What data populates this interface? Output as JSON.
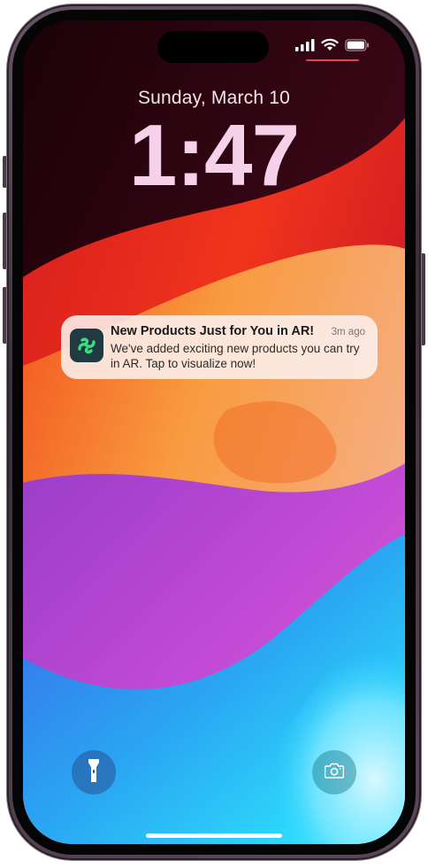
{
  "lockscreen": {
    "date": "Sunday, March 10",
    "time": "1:47"
  },
  "status_bar": {
    "icons": [
      "cellular-signal-icon",
      "wifi-icon",
      "battery-icon"
    ]
  },
  "notification": {
    "app_icon": "app-logo-icon",
    "title": "New Products Just for You in AR!",
    "timestamp": "3m ago",
    "body": "We've added exciting new products you can try in AR. Tap to visualize now!"
  },
  "quick_actions": {
    "left": "flashlight-icon",
    "right": "camera-icon"
  },
  "colors": {
    "time_text": "#f6d2ea",
    "notification_bg": "#fcf0ee",
    "app_icon_bg": "#1f3a40",
    "app_icon_glyph": "#3ddc84"
  }
}
